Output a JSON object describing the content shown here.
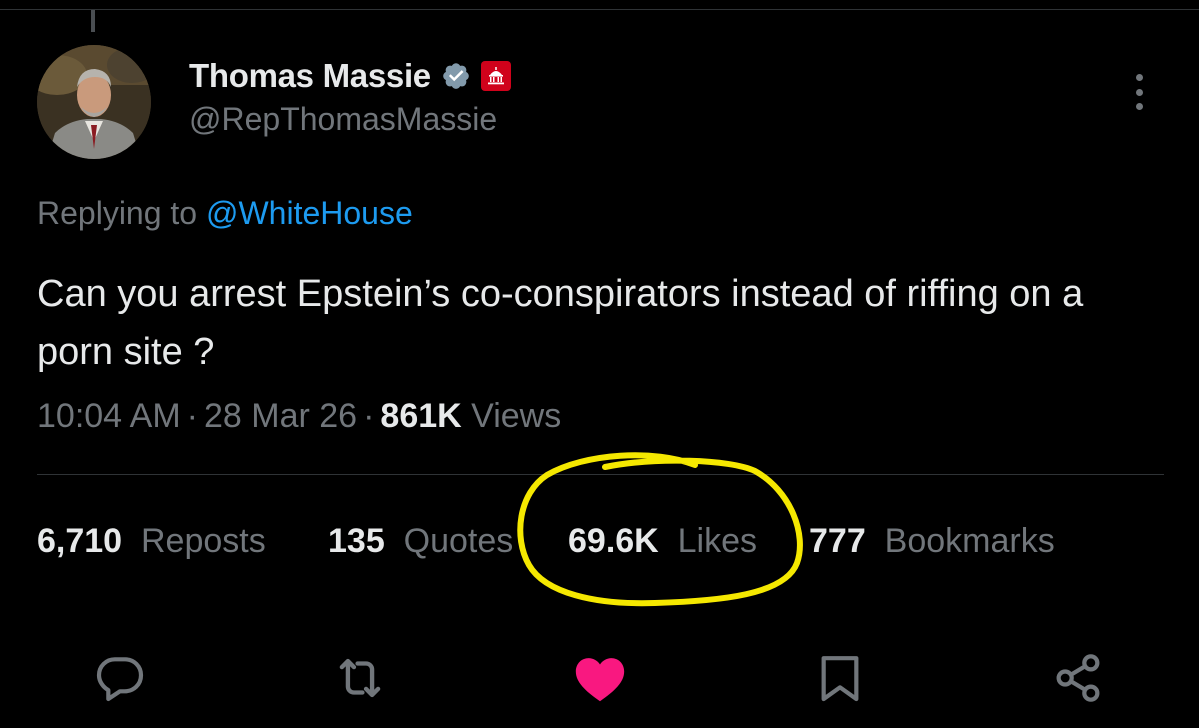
{
  "author": {
    "display_name": "Thomas Massie",
    "handle": "@RepThomasMassie",
    "verified": true,
    "government_badge": true
  },
  "reply": {
    "prefix": "Replying to",
    "mention": "@WhiteHouse"
  },
  "tweet": {
    "text": "Can you arrest Epstein’s co-conspirators instead of riffing on a porn site ?"
  },
  "meta": {
    "time": "10:04 AM",
    "date": "28 Mar 26",
    "views_count": "861K",
    "views_label": "Views",
    "separator": "·"
  },
  "stats": {
    "reposts_count": "6,710",
    "reposts_label": "Reposts",
    "quotes_count": "135",
    "quotes_label": "Quotes",
    "likes_count": "69.6K",
    "likes_label": "Likes",
    "bookmarks_count": "777",
    "bookmarks_label": "Bookmarks"
  },
  "actions": [
    {
      "icon": "reply-icon"
    },
    {
      "icon": "repost-icon"
    },
    {
      "icon": "like-heart-icon",
      "active": true
    },
    {
      "icon": "bookmark-icon"
    },
    {
      "icon": "share-icon"
    }
  ],
  "colors": {
    "background": "#000000",
    "primary_text": "#e7e9ea",
    "secondary_text": "#71767b",
    "link": "#1d9bf0",
    "like_active": "#f91880",
    "verified": "#829aab",
    "gov_badge": "#d0021b",
    "highlight_annotation": "#f5e800"
  }
}
